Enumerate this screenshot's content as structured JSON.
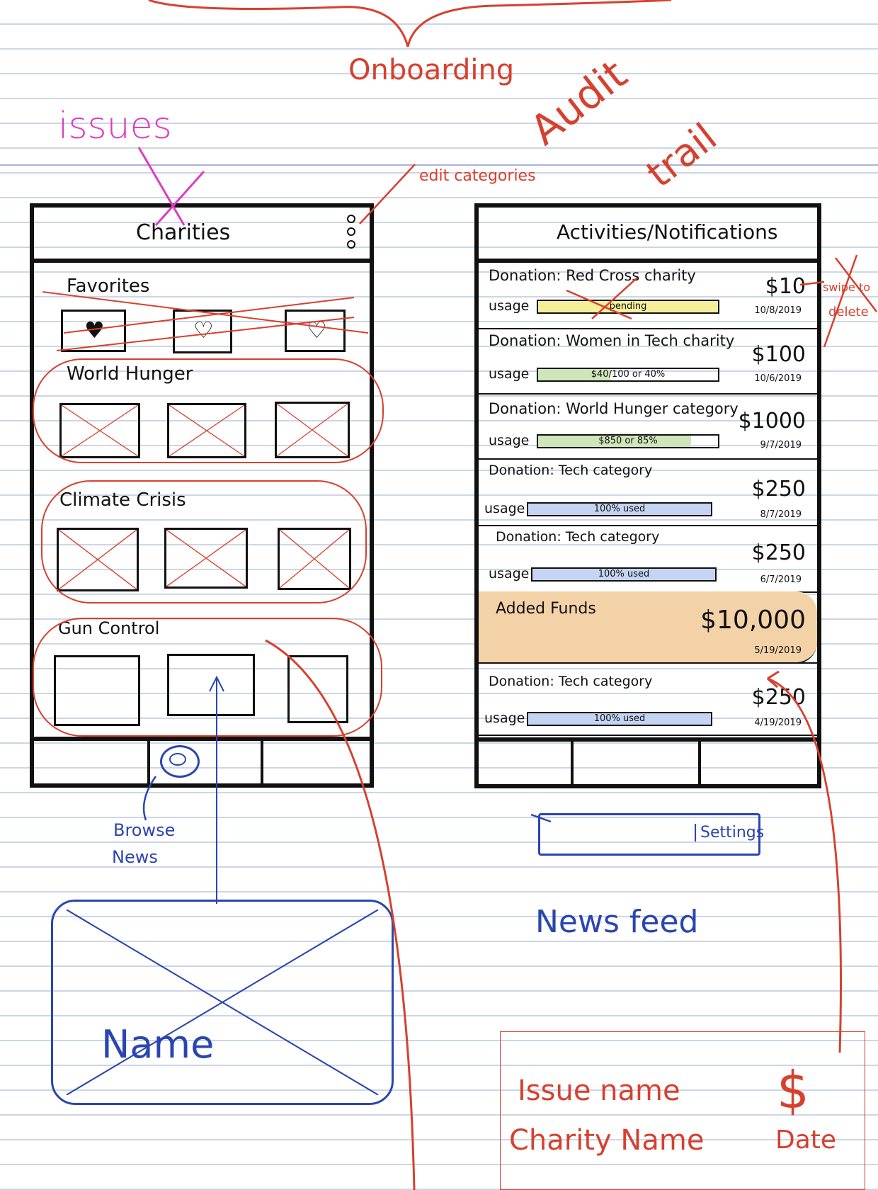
{
  "annotations": {
    "onboarding": "Onboarding",
    "issues": "issues",
    "edit_categories": "edit categories",
    "audit_trail_1": "Audit",
    "audit_trail_2": "trail",
    "swipe_to_delete_1": "swipe to",
    "swipe_to_delete_2": "delete",
    "browse_news_1": "Browse",
    "browse_news_2": "News",
    "news_feed": "News feed",
    "settings": "Settings",
    "card_name": "Name",
    "issue_name": "Issue name",
    "charity_name": "Charity Name",
    "dollar": "$",
    "date": "Date"
  },
  "charities_screen": {
    "title": "Charities",
    "sections": [
      "Favorites",
      "World Hunger",
      "Climate Crisis",
      "Gun Control"
    ]
  },
  "activities_screen": {
    "title": "Activities/Notifications",
    "items": [
      {
        "title": "Donation: Red Cross charity",
        "usage_label": "usage",
        "bar_text": "pending",
        "amount": "$10",
        "date": "10/8/2019",
        "fill": 1.0,
        "fill_color": "#f5ef9a"
      },
      {
        "title": "Donation: Women in Tech charity",
        "usage_label": "usage",
        "bar_text": "$40/100 or 40%",
        "amount": "$100",
        "date": "10/6/2019",
        "fill": 0.4,
        "fill_color": "#cfe6b8"
      },
      {
        "title": "Donation: World Hunger category",
        "usage_label": "usage",
        "bar_text": "$850 or 85%",
        "amount": "$1000",
        "date": "9/7/2019",
        "fill": 0.85,
        "fill_color": "#cfe6b8"
      },
      {
        "title": "Donation: Tech category",
        "usage_label": "usage",
        "bar_text": "100% used",
        "amount": "$250",
        "date": "8/7/2019",
        "fill": 1.0,
        "fill_color": "#c5d4f2"
      },
      {
        "title": "Donation: Tech category",
        "usage_label": "usage",
        "bar_text": "100% used",
        "amount": "$250",
        "date": "6/7/2019",
        "fill": 1.0,
        "fill_color": "#c5d4f2"
      }
    ],
    "added_funds": {
      "title": "Added Funds",
      "amount": "$10,000",
      "date": "5/19/2019"
    },
    "last_item": {
      "title": "Donation: Tech category",
      "usage_label": "usage",
      "bar_text": "100% used",
      "amount": "$250",
      "date": "4/19/2019",
      "fill": 1.0,
      "fill_color": "#c5d4f2"
    }
  },
  "colors": {
    "annotation_red": "#d7402e",
    "annotation_blue": "#2a46b0",
    "annotation_pink": "#e03cc4",
    "highlight_orange": "#f4d2a8"
  }
}
